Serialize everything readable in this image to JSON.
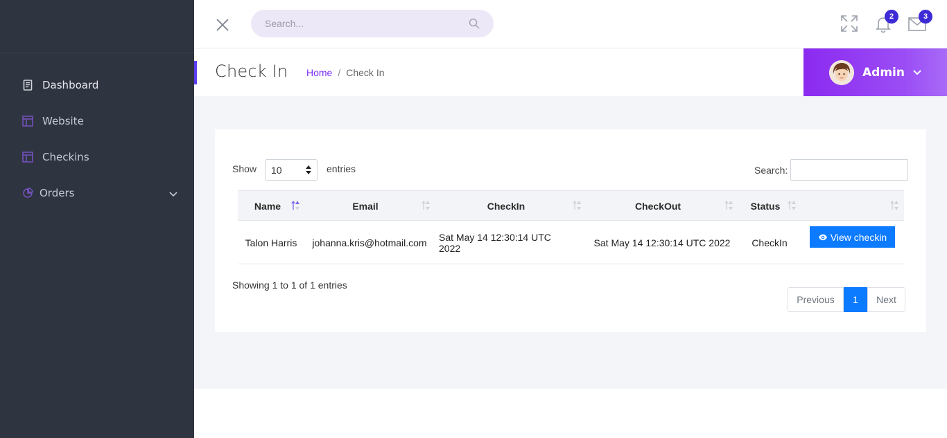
{
  "sidebar": {
    "items": [
      {
        "label": "Dashboard",
        "icon": "book-icon"
      },
      {
        "label": "Website",
        "icon": "layout-icon"
      },
      {
        "label": "Checkins",
        "icon": "layout-icon"
      },
      {
        "label": "Orders",
        "icon": "pie-chart-icon"
      }
    ]
  },
  "topbar": {
    "search_placeholder": "Search...",
    "notifications_count": "2",
    "messages_count": "3"
  },
  "header": {
    "title": "Check In",
    "breadcrumb_home": "Home",
    "breadcrumb_sep": "/",
    "breadcrumb_current": "Check In",
    "user_name": "Admin"
  },
  "table_controls": {
    "show_label": "Show",
    "page_length": "10",
    "entries_label": "entries",
    "search_label": "Search:"
  },
  "table": {
    "columns": [
      "Name",
      "Email",
      "CheckIn",
      "CheckOut",
      "Status",
      ""
    ],
    "rows": [
      {
        "name": "Talon Harris",
        "email": "johanna.kris@hotmail.com",
        "checkin": "Sat May 14 12:30:14 UTC 2022",
        "checkout": "Sat May 14 12:30:14 UTC 2022",
        "status": "CheckIn",
        "action_label": "View checkin"
      }
    ]
  },
  "footer": {
    "info": "Showing 1 to 1 of 1 entries",
    "prev_label": "Previous",
    "current_page": "1",
    "next_label": "Next"
  },
  "colors": {
    "sidebar_bg": "#2f3441",
    "accent_purple": "#8b2af0",
    "primary_blue": "#0d7bff",
    "badge": "#3d2bd6"
  }
}
